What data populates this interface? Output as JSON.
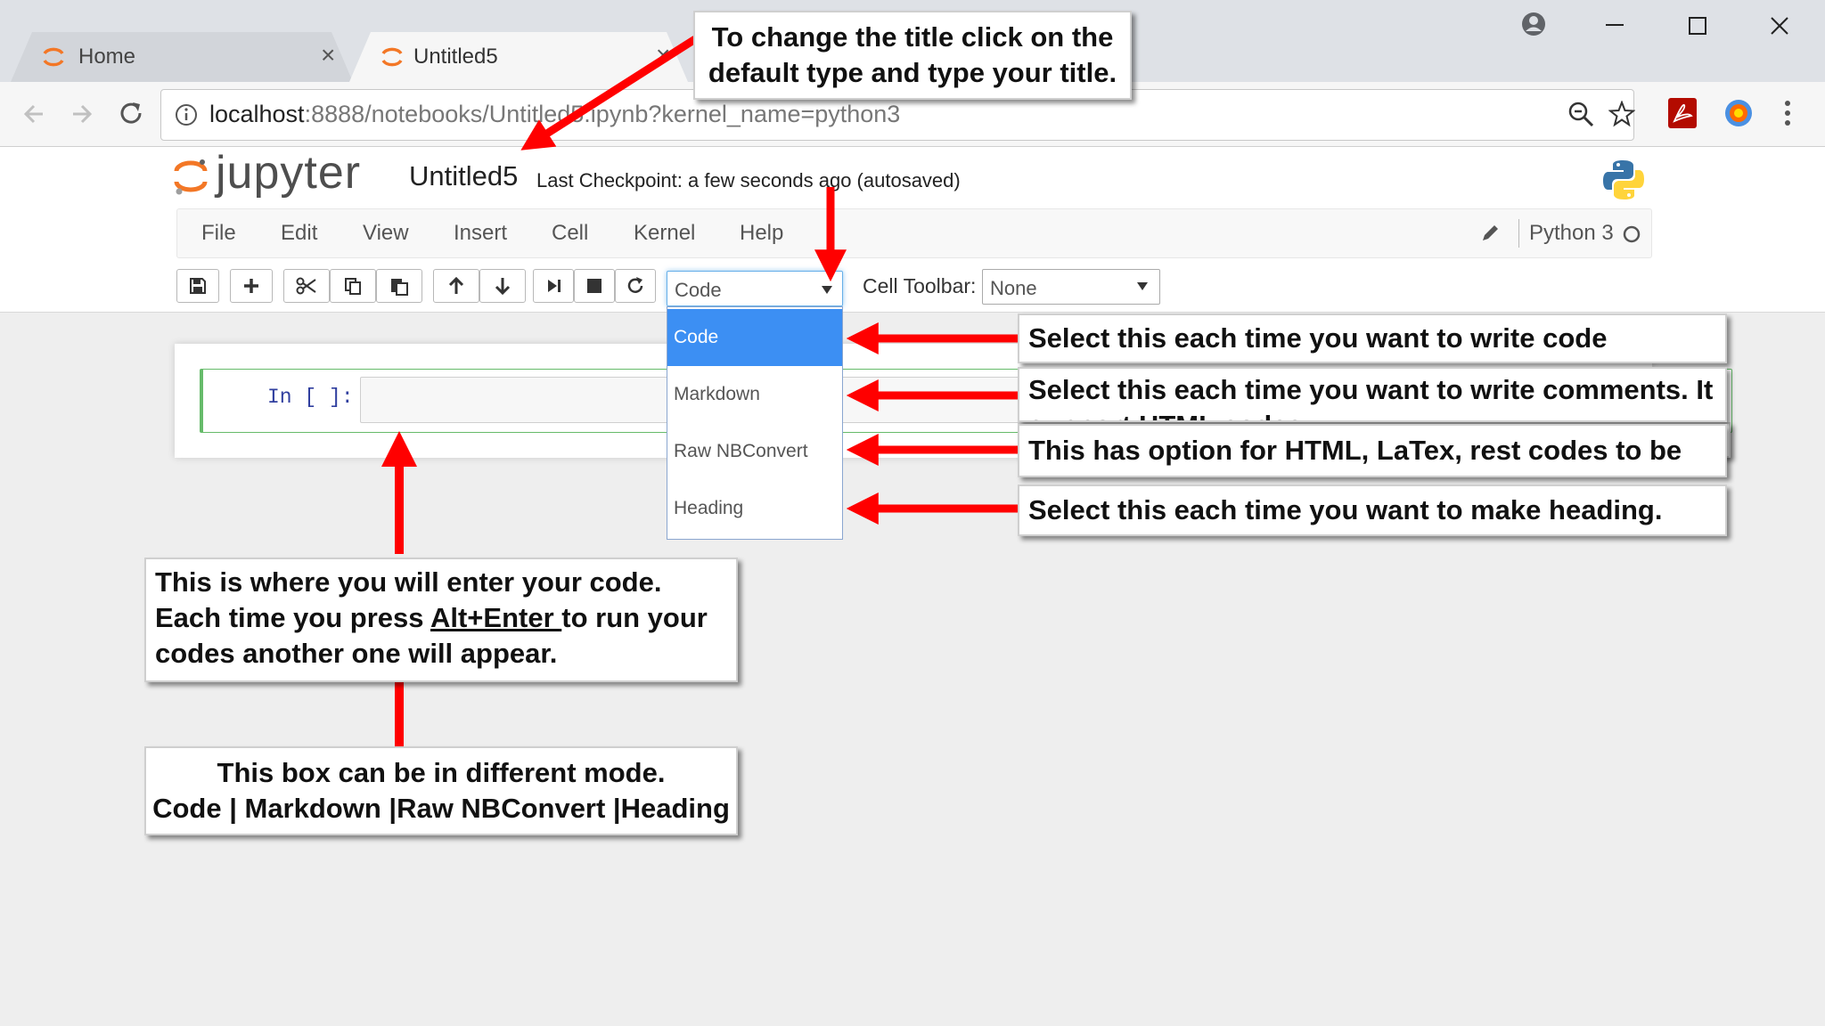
{
  "browser": {
    "tabs": [
      {
        "label": "Home",
        "close": "×"
      },
      {
        "label": "Untitled5",
        "close": "×"
      }
    ],
    "url_host": "localhost",
    "url_rest": ":8888/notebooks/Untitled5.ipynb?kernel_name=python3"
  },
  "jupyter": {
    "logo_text": "jupyter",
    "notebook_title": "Untitled5",
    "checkpoint_text": "Last Checkpoint: a few seconds ago (autosaved)",
    "menu": [
      "File",
      "Edit",
      "View",
      "Insert",
      "Cell",
      "Kernel",
      "Help"
    ],
    "kernel_name": "Python 3",
    "cell_type_selected": "Code",
    "cell_type_options": [
      "Code",
      "Markdown",
      "Raw NBConvert",
      "Heading"
    ],
    "cell_toolbar_label": "Cell Toolbar:",
    "cell_toolbar_value": "None",
    "input_prompt": "In [ ]:"
  },
  "annotations": {
    "title_hint": "To change the title click on the default type and type your title.",
    "code_hint": "Select this each time you want to write code",
    "markdown_hint": "Select this each time you want to write comments. It support HTML codes.",
    "raw_hint": "This has option for HTML, LaTex, rest codes to be run.",
    "heading_hint": "Select this each time you want to make heading.",
    "cell_hint_before": "This is where you will enter your code. Each time you press ",
    "cell_hint_key": "Alt+Enter ",
    "cell_hint_after": "to run your codes another one will appear.",
    "mode_hint_line1": "This box can be in different mode.",
    "mode_hint_line2": "Code | Markdown |Raw NBConvert |Heading"
  },
  "colors": {
    "accent_blue": "#3c8ff3",
    "arrow_red": "#ff0000",
    "jupyter_orange": "#f37726",
    "cell_green": "#66bb6a"
  }
}
